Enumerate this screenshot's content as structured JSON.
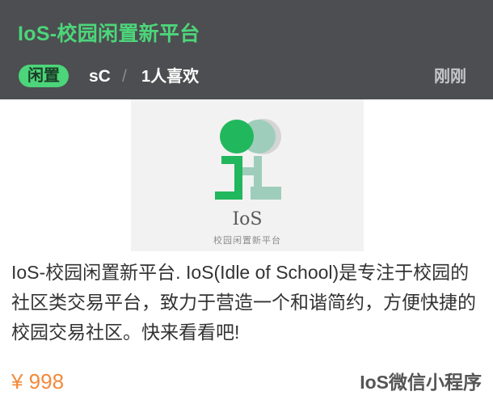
{
  "header": {
    "title": "IoS-校园闲置新平台",
    "tag": "闲置",
    "author": "sC",
    "divider": "/",
    "likes": "1人喜欢",
    "time": "刚刚",
    "background_color": "#4d4e51",
    "title_color": "#4cd57a"
  },
  "cover": {
    "logo_text": "IoS",
    "logo_subtitle": "校园闲置新平台",
    "logo_colors": {
      "dark_green": "#21b75c",
      "light_green": "#9fcdbb",
      "gray": "#d5d5d5"
    }
  },
  "body": {
    "description": "IoS-校园闲置新平台. IoS(Idle of School)是专注于校园的社区类交易平台，致力于营造一个和谐简约，方便快捷的校园交易社区。快来看看吧!",
    "price": "¥ 998",
    "price_color": "#f28a3a",
    "source": "IoS微信小程序"
  }
}
